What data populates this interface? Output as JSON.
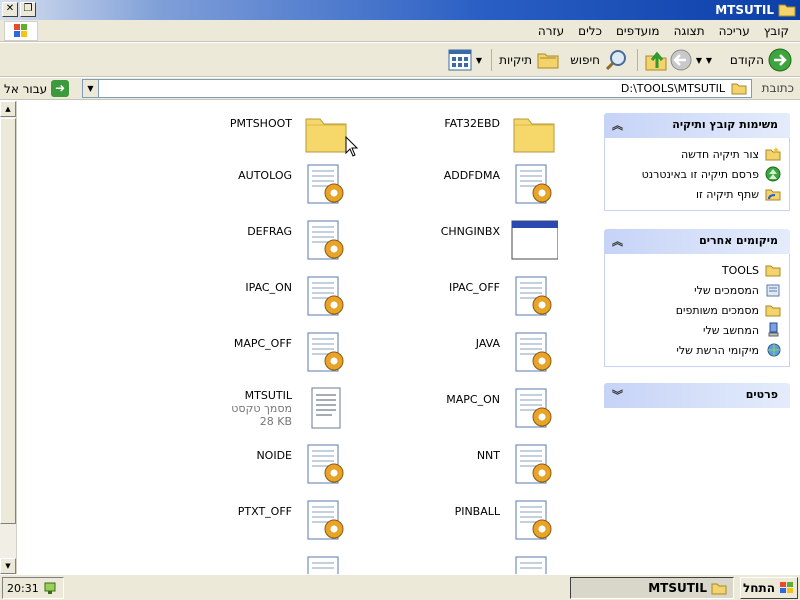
{
  "window": {
    "title": "MTSUTIL"
  },
  "menu": {
    "items": [
      "קובץ",
      "עריכה",
      "תצוגה",
      "מועדפים",
      "כלים",
      "עזרה"
    ]
  },
  "toolbar": {
    "back_label": "הקודם",
    "search_label": "חיפוש",
    "folders_label": "תיקיות"
  },
  "address": {
    "label": "כתובת",
    "value": "D:\\TOOLS\\MTSUTIL",
    "go_label": "עבור אל"
  },
  "files_right": [
    {
      "name": "FAT32EBD",
      "icon": "folder-icon"
    },
    {
      "name": "ADDFDMA",
      "icon": "batch-file-icon"
    },
    {
      "name": "CHNGINBX",
      "icon": "window-app-icon"
    },
    {
      "name": "IPAC_OFF",
      "icon": "batch-file-icon"
    },
    {
      "name": "JAVA",
      "icon": "batch-file-icon"
    },
    {
      "name": "MAPC_ON",
      "icon": "batch-file-icon"
    },
    {
      "name": "NNT",
      "icon": "batch-file-icon"
    },
    {
      "name": "PINBALL",
      "icon": "batch-file-icon"
    }
  ],
  "files_left": [
    {
      "name": "PMTSHOOT",
      "icon": "folder-icon"
    },
    {
      "name": "AUTOLOG",
      "icon": "batch-file-icon"
    },
    {
      "name": "DEFRAG",
      "icon": "batch-file-icon"
    },
    {
      "name": "IPAC_ON",
      "icon": "batch-file-icon"
    },
    {
      "name": "MAPC_OFF",
      "icon": "batch-file-icon"
    },
    {
      "name": "MTSUTIL",
      "icon": "text-document-icon",
      "type": "מסמך טקסט",
      "size": "28 KB"
    },
    {
      "name": "NOIDE",
      "icon": "batch-file-icon"
    },
    {
      "name": "PTXT_OFF",
      "icon": "batch-file-icon"
    }
  ],
  "pane_tasks": {
    "title": "משימות קובץ ותיקיה",
    "links": [
      {
        "label": "צור תיקיה חדשה",
        "icon": "new-folder-icon"
      },
      {
        "label": "פרסם תיקיה זו באינטרנט",
        "icon": "publish-web-icon"
      },
      {
        "label": "שתף תיקיה זו",
        "icon": "share-folder-icon"
      }
    ]
  },
  "pane_places": {
    "title": "מיקומים אחרים",
    "links": [
      {
        "label": "TOOLS",
        "icon": "folder-icon"
      },
      {
        "label": "המסמכים שלי",
        "icon": "my-documents-icon"
      },
      {
        "label": "מסמכים משותפים",
        "icon": "shared-documents-icon"
      },
      {
        "label": "המחשב שלי",
        "icon": "my-computer-icon"
      },
      {
        "label": "מיקומי הרשת שלי",
        "icon": "network-places-icon"
      }
    ]
  },
  "pane_details": {
    "title": "פרטים"
  },
  "taskbar": {
    "start_label": "התחל",
    "task_label": "MTSUTIL",
    "clock": "20:31"
  }
}
